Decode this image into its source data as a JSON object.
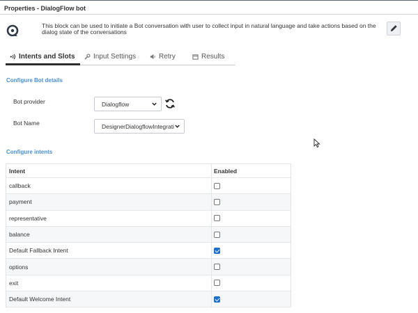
{
  "title": "Properties - DialogFlow bot",
  "description": "This block can be used to initiate a Bot conversation with user to collect input in natural language and take actions based on the dialog state of the conversations",
  "tabs": [
    {
      "label": "Intents and Slots",
      "icon": "signal-icon",
      "active": true
    },
    {
      "label": "Input Settings",
      "icon": "wrench-icon",
      "active": false
    },
    {
      "label": "Retry",
      "icon": "speaker-icon",
      "active": false
    },
    {
      "label": "Results",
      "icon": "calendar-icon",
      "active": false
    }
  ],
  "bot_details": {
    "section_title": "Configure Bot details",
    "provider_label": "Bot provider",
    "provider_value": "Dialogflow",
    "name_label": "Bot Name",
    "name_value": "DesignerDialogflowIntegrati"
  },
  "intents": {
    "section_title": "Configure intents",
    "columns": [
      "Intent",
      "Enabled"
    ],
    "rows": [
      {
        "intent": "callback",
        "enabled": false
      },
      {
        "intent": "payment",
        "enabled": false
      },
      {
        "intent": "representative",
        "enabled": false
      },
      {
        "intent": "balance",
        "enabled": false
      },
      {
        "intent": "Default Fallback Intent",
        "enabled": true
      },
      {
        "intent": "options",
        "enabled": false
      },
      {
        "intent": "exit",
        "enabled": false
      },
      {
        "intent": "Default Welcome Intent",
        "enabled": true
      }
    ]
  },
  "colors": {
    "accent": "#4a8fd4",
    "checkbox_checked": "#1e6fcf"
  }
}
